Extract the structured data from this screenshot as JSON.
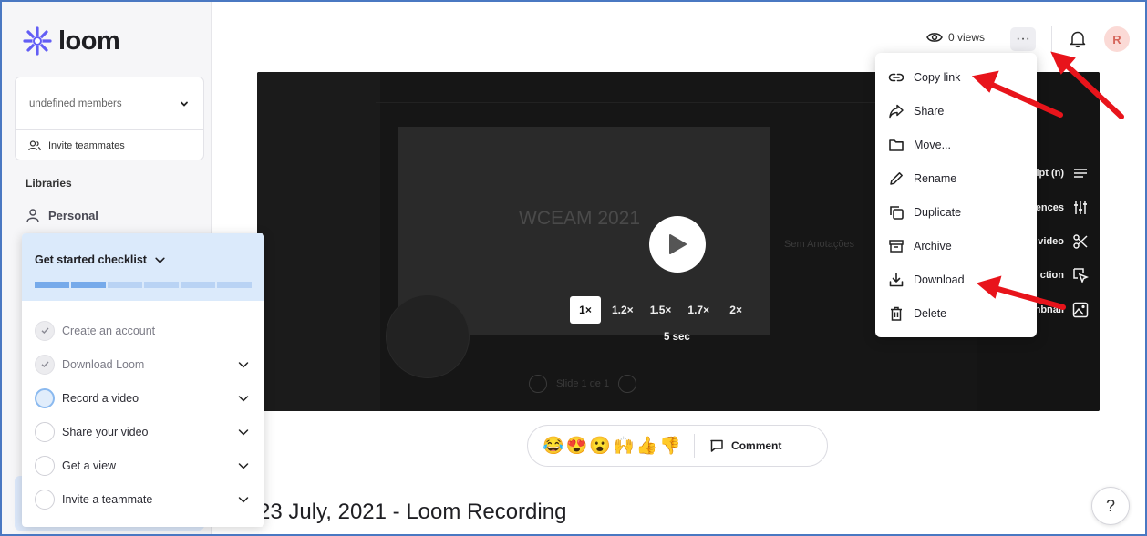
{
  "brand": {
    "name": "loom",
    "color": "#625df5"
  },
  "sidebar": {
    "workspace_label": "undefined members",
    "invite_label": "Invite teammates",
    "libraries_heading": "Libraries",
    "personal_label": "Personal"
  },
  "checklist": {
    "title": "Get started checklist",
    "progress": {
      "completed": 2,
      "total": 6
    },
    "items": [
      {
        "label": "Create an account",
        "status": "done"
      },
      {
        "label": "Download Loom",
        "status": "done"
      },
      {
        "label": "Record a video",
        "status": "active"
      },
      {
        "label": "Share your video",
        "status": "todo"
      },
      {
        "label": "Get a view",
        "status": "todo"
      },
      {
        "label": "Invite a teammate",
        "status": "todo"
      }
    ]
  },
  "topbar": {
    "views_label": "0 views",
    "more_label": "···",
    "avatar_initial": "R"
  },
  "video": {
    "slide_text": "WCEAM 2021",
    "sem_text": "Sem Anotações",
    "nav_text": "Slide 1 de 1",
    "speeds": [
      "1×",
      "1.2×",
      "1.5×",
      "1.7×",
      "2×"
    ],
    "selected_speed": "1×",
    "skip_label": "5 sec",
    "side_actions": [
      "ipt (n)",
      "ences",
      "video",
      "ction",
      "nbnail"
    ]
  },
  "menu": {
    "items": [
      {
        "label": "Copy link",
        "icon": "link-icon"
      },
      {
        "label": "Share",
        "icon": "share-arrow-icon"
      },
      {
        "label": "Move...",
        "icon": "folder-icon"
      },
      {
        "label": "Rename",
        "icon": "pencil-icon"
      },
      {
        "label": "Duplicate",
        "icon": "duplicate-icon"
      },
      {
        "label": "Archive",
        "icon": "archive-icon"
      },
      {
        "label": "Download",
        "icon": "download-icon"
      },
      {
        "label": "Delete",
        "icon": "trash-icon"
      }
    ]
  },
  "reactions": {
    "emojis": [
      "😂",
      "😍",
      "😮",
      "🙌",
      "👍",
      "👎"
    ],
    "comment_label": "Comment"
  },
  "page_title": "23 July, 2021 - Loom Recording",
  "help_label": "?",
  "colors": {
    "annotation_arrow": "#e8141b",
    "checklist_bg": "#dbeafb",
    "progress_done": "#76aaea"
  }
}
